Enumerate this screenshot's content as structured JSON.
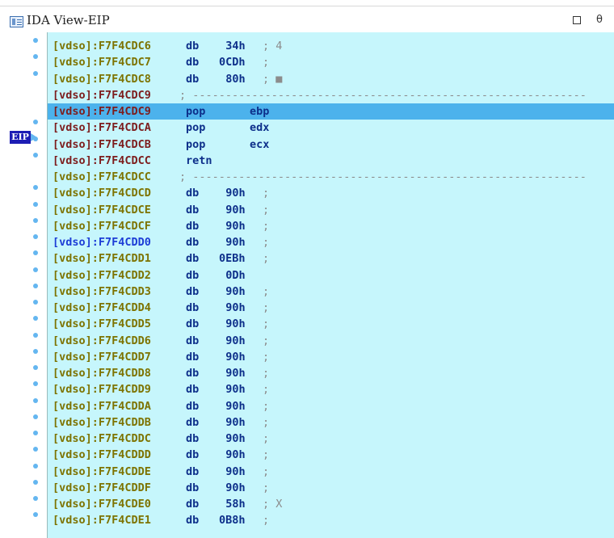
{
  "window": {
    "title": "IDA View-EIP",
    "restore_icon": "restore-icon",
    "float_icon": "float-icon",
    "float_glyph": "3"
  },
  "gutter": {
    "eip_label": "EIP"
  },
  "listing": [
    {
      "addr": "[vdso]:F7F4CDC6",
      "mnem": "db",
      "opnd": "34h",
      "cmt": "; 4",
      "addr_color": "olive"
    },
    {
      "addr": "[vdso]:F7F4CDC7",
      "mnem": "db",
      "opnd": "0CDh",
      "cmt": ";",
      "addr_color": "olive"
    },
    {
      "addr": "[vdso]:F7F4CDC8",
      "mnem": "db",
      "opnd": "80h",
      "cmt": "; ■",
      "addr_color": "olive"
    },
    {
      "addr": "[vdso]:F7F4CDC9",
      "mnem": "",
      "opnd": "",
      "cmt": "; ------------------------------------------------------------",
      "addr_color": "red"
    },
    {
      "addr": "[vdso]:F7F4CDC9",
      "mnem": "pop",
      "opnd": "ebp",
      "cmt": "",
      "addr_color": "red",
      "highlight": true
    },
    {
      "addr": "[vdso]:F7F4CDCA",
      "mnem": "pop",
      "opnd": "edx",
      "cmt": "",
      "addr_color": "red"
    },
    {
      "addr": "[vdso]:F7F4CDCB",
      "mnem": "pop",
      "opnd": "ecx",
      "cmt": "",
      "addr_color": "red"
    },
    {
      "addr": "[vdso]:F7F4CDCC",
      "mnem": "retn",
      "opnd": "",
      "cmt": "",
      "addr_color": "red"
    },
    {
      "addr": "[vdso]:F7F4CDCC",
      "mnem": "",
      "opnd": "",
      "cmt": "; ------------------------------------------------------------",
      "addr_color": "olive"
    },
    {
      "addr": "[vdso]:F7F4CDCD",
      "mnem": "db",
      "opnd": "90h",
      "cmt": ";",
      "addr_color": "olive"
    },
    {
      "addr": "[vdso]:F7F4CDCE",
      "mnem": "db",
      "opnd": "90h",
      "cmt": ";",
      "addr_color": "olive"
    },
    {
      "addr": "[vdso]:F7F4CDCF",
      "mnem": "db",
      "opnd": "90h",
      "cmt": ";",
      "addr_color": "olive"
    },
    {
      "addr": "[vdso]:F7F4CDD0",
      "mnem": "db",
      "opnd": "90h",
      "cmt": ";",
      "addr_color": "blue"
    },
    {
      "addr": "[vdso]:F7F4CDD1",
      "mnem": "db",
      "opnd": "0EBh",
      "cmt": ";",
      "addr_color": "olive"
    },
    {
      "addr": "[vdso]:F7F4CDD2",
      "mnem": "db",
      "opnd": "0Dh",
      "cmt": "",
      "addr_color": "olive"
    },
    {
      "addr": "[vdso]:F7F4CDD3",
      "mnem": "db",
      "opnd": "90h",
      "cmt": ";",
      "addr_color": "olive"
    },
    {
      "addr": "[vdso]:F7F4CDD4",
      "mnem": "db",
      "opnd": "90h",
      "cmt": ";",
      "addr_color": "olive"
    },
    {
      "addr": "[vdso]:F7F4CDD5",
      "mnem": "db",
      "opnd": "90h",
      "cmt": ";",
      "addr_color": "olive"
    },
    {
      "addr": "[vdso]:F7F4CDD6",
      "mnem": "db",
      "opnd": "90h",
      "cmt": ";",
      "addr_color": "olive"
    },
    {
      "addr": "[vdso]:F7F4CDD7",
      "mnem": "db",
      "opnd": "90h",
      "cmt": ";",
      "addr_color": "olive"
    },
    {
      "addr": "[vdso]:F7F4CDD8",
      "mnem": "db",
      "opnd": "90h",
      "cmt": ";",
      "addr_color": "olive"
    },
    {
      "addr": "[vdso]:F7F4CDD9",
      "mnem": "db",
      "opnd": "90h",
      "cmt": ";",
      "addr_color": "olive"
    },
    {
      "addr": "[vdso]:F7F4CDDA",
      "mnem": "db",
      "opnd": "90h",
      "cmt": ";",
      "addr_color": "olive"
    },
    {
      "addr": "[vdso]:F7F4CDDB",
      "mnem": "db",
      "opnd": "90h",
      "cmt": ";",
      "addr_color": "olive"
    },
    {
      "addr": "[vdso]:F7F4CDDC",
      "mnem": "db",
      "opnd": "90h",
      "cmt": ";",
      "addr_color": "olive"
    },
    {
      "addr": "[vdso]:F7F4CDDD",
      "mnem": "db",
      "opnd": "90h",
      "cmt": ";",
      "addr_color": "olive"
    },
    {
      "addr": "[vdso]:F7F4CDDE",
      "mnem": "db",
      "opnd": "90h",
      "cmt": ";",
      "addr_color": "olive"
    },
    {
      "addr": "[vdso]:F7F4CDDF",
      "mnem": "db",
      "opnd": "90h",
      "cmt": ";",
      "addr_color": "olive"
    },
    {
      "addr": "[vdso]:F7F4CDE0",
      "mnem": "db",
      "opnd": "58h",
      "cmt": "; X",
      "addr_color": "olive"
    },
    {
      "addr": "[vdso]:F7F4CDE1",
      "mnem": "db",
      "opnd": "0B8h",
      "cmt": ";",
      "addr_color": "olive"
    }
  ],
  "colors": {
    "background": "#c6f6fc",
    "highlight": "#4cb2ec",
    "mnemonic": "#0d2f8a",
    "addr_olive": "#7d7300",
    "addr_red": "#7d1d1d",
    "addr_blue": "#1d3dd6",
    "eip_badge": "#1d1db4"
  }
}
